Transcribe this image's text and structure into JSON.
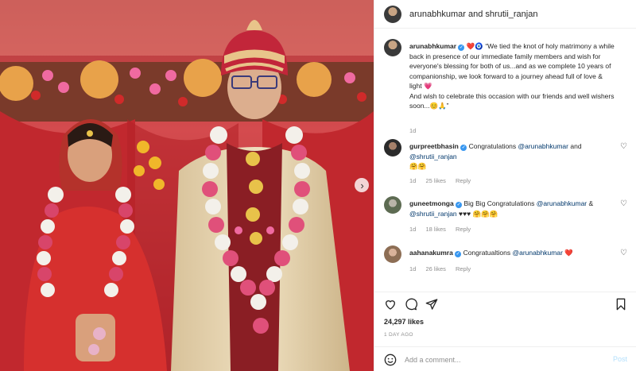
{
  "header": {
    "user1": "arunabhkumar",
    "and": "and",
    "user2": "shrutii_ranjan"
  },
  "caption": {
    "username": "arunabhkumar",
    "emojis": "❤️🧿",
    "text1": "“We tied the knot of holy matrimony a while back in presence of our immediate family members and wish for everyone's blessing for both of us...and as we complete 10 years of companionship, we look forward to a journey ahead full of love & light 💗",
    "text2": "And wish to celebrate this occasion with our friends and well wishers soon...😊🙏”",
    "time": "1d"
  },
  "comments": [
    {
      "username": "gurpreetbhasin",
      "text": "Congratulations",
      "mention1": "@arunabhkumar",
      "mid": " and ",
      "mention2": "@shrutii_ranjan",
      "tail": "",
      "emojis": "🤗🤗",
      "time": "1d",
      "likes": "25 likes",
      "reply": "Reply"
    },
    {
      "username": "guneetmonga",
      "text": "Big Big Congratulations",
      "mention1": "@arunabhkumar",
      "mid": " & ",
      "mention2": "@shrutii_ranjan",
      "tail": " ♥♥♥ 🤗🤗🤗",
      "emojis": "",
      "time": "1d",
      "likes": "18 likes",
      "reply": "Reply"
    },
    {
      "username": "aahanakumra",
      "text": "Congratualtions",
      "mention1": "@arunabhkumar",
      "mid": "",
      "mention2": "",
      "tail": " ❤️",
      "emojis": "",
      "time": "1d",
      "likes": "26 likes",
      "reply": "Reply"
    }
  ],
  "footer": {
    "likes": "24,297 likes",
    "time_ago": "1 DAY AGO",
    "add_placeholder": "Add a comment...",
    "post_label": "Post"
  },
  "colors": {
    "verified": "#3897f0",
    "mention": "#00376b",
    "post_disabled": "#b2dffc",
    "photo_backdrop": "#c9343a"
  },
  "icons": [
    "heart-icon",
    "comment-icon",
    "share-icon",
    "bookmark-icon",
    "emoji-icon",
    "verified-icon",
    "chevron-right-icon"
  ]
}
